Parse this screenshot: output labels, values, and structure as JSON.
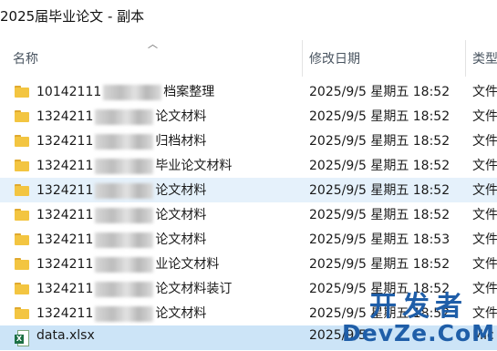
{
  "window": {
    "title": "2025届毕业论文 - 副本"
  },
  "columns": {
    "name": "名称",
    "date": "修改日期",
    "type": "类型"
  },
  "rows": [
    {
      "name_prefix": "10142111",
      "name_suffix": "档案整理",
      "date": "2025/9/5 星期五 18:52",
      "type": "文件"
    },
    {
      "name_prefix": "1324211",
      "name_suffix": "论文材料",
      "date": "2025/9/5 星期五 18:52",
      "type": "文件"
    },
    {
      "name_prefix": "1324211",
      "name_suffix": "归档材料",
      "date": "2025/9/5 星期五 18:52",
      "type": "文件"
    },
    {
      "name_prefix": "1324211",
      "name_suffix": "毕业论文材料",
      "date": "2025/9/5 星期五 18:52",
      "type": "文件"
    },
    {
      "name_prefix": "1324211",
      "name_suffix": "论文材料",
      "date": "2025/9/5 星期五 18:52",
      "type": "文件"
    },
    {
      "name_prefix": "1324211",
      "name_suffix": "论文材料",
      "date": "2025/9/5 星期五 18:52",
      "type": "文件"
    },
    {
      "name_prefix": "1324211",
      "name_suffix": "论文材料",
      "date": "2025/9/5 星期五 18:53",
      "type": "文件"
    },
    {
      "name_prefix": "1324211",
      "name_suffix": "业论文材料",
      "date": "2025/9/5 星期五 18:52",
      "type": "文件"
    },
    {
      "name_prefix": "1324211",
      "name_suffix": "论文材料装订",
      "date": "2025/9/5 星期五 18:52",
      "type": "文件"
    },
    {
      "name_prefix": "1324211",
      "name_suffix": "论文材料",
      "date": "2025/9/5 星期五 18:52",
      "type": "文件"
    }
  ],
  "file_row": {
    "name": "data.xlsx",
    "date": "2025/9/5",
    "type": "Mic"
  },
  "watermark": {
    "top": "开发者",
    "bottom": "DevZe.CoM"
  }
}
